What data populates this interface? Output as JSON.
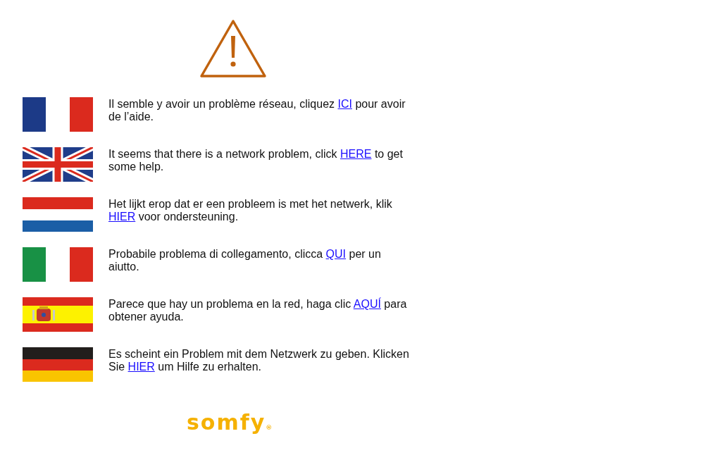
{
  "messages": [
    {
      "kind": "fr",
      "before": "Il semble y avoir un problème réseau, cliquez ",
      "link": "ICI",
      "after": " pour avoir de l’aide."
    },
    {
      "kind": "gb",
      "before": "It seems that there is a network problem, click ",
      "link": "HERE",
      "after": " to get some help."
    },
    {
      "kind": "nl",
      "before": "Het lijkt erop dat er een probleem is met het netwerk, klik ",
      "link": "HIER",
      "after": " voor ondersteuning."
    },
    {
      "kind": "it",
      "before": "Probabile problema di collegamento, clicca ",
      "link": "QUI",
      "after": " per un aiutto."
    },
    {
      "kind": "es",
      "before": "Parece que hay un problema en la red, haga clic ",
      "link": "AQUÍ",
      "after": " para obtener ayuda."
    },
    {
      "kind": "de",
      "before": "Es scheint ein Problem mit dem Netzwerk zu geben. Klicken Sie ",
      "link": "HIER",
      "after": " um Hilfe zu erhalten."
    }
  ],
  "logo": {
    "text": "somfy",
    "mark": "®"
  }
}
